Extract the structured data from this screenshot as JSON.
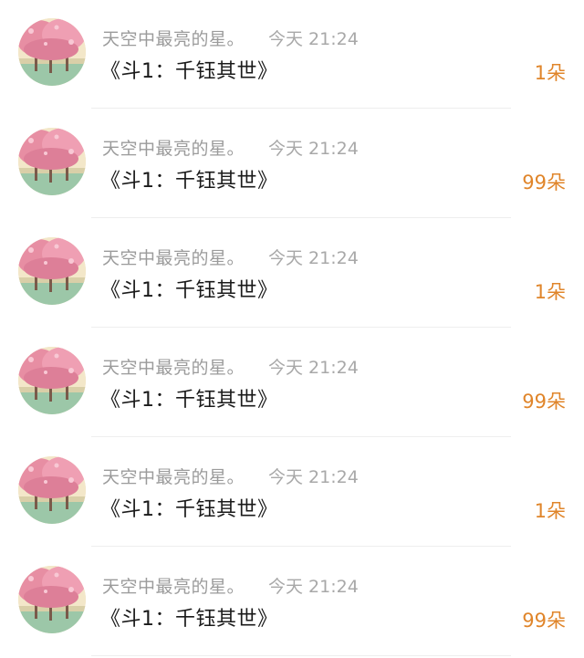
{
  "messages": [
    {
      "username": "天空中最亮的星。",
      "time": "今天 21:24",
      "text": "《斗1：千钰其世》",
      "amount": "1朵",
      "avatar_icon": "cherry-blossom-tree-avatar"
    },
    {
      "username": "天空中最亮的星。",
      "time": "今天 21:24",
      "text": "《斗1：千钰其世》",
      "amount": "99朵",
      "avatar_icon": "cherry-blossom-tree-avatar"
    },
    {
      "username": "天空中最亮的星。",
      "time": "今天 21:24",
      "text": "《斗1：千钰其世》",
      "amount": "1朵",
      "avatar_icon": "cherry-blossom-tree-avatar"
    },
    {
      "username": "天空中最亮的星。",
      "time": "今天 21:24",
      "text": "《斗1：千钰其世》",
      "amount": "99朵",
      "avatar_icon": "cherry-blossom-tree-avatar"
    },
    {
      "username": "天空中最亮的星。",
      "time": "今天 21:24",
      "text": "《斗1：千钰其世》",
      "amount": "1朵",
      "avatar_icon": "cherry-blossom-tree-avatar"
    },
    {
      "username": "天空中最亮的星。",
      "time": "今天 21:24",
      "text": "《斗1：千钰其世》",
      "amount": "99朵",
      "avatar_icon": "cherry-blossom-tree-avatar"
    }
  ],
  "colors": {
    "amount": "#e0852a",
    "username": "#9b9b9b",
    "text": "#1a1a1a",
    "divider": "#eeeeee"
  }
}
